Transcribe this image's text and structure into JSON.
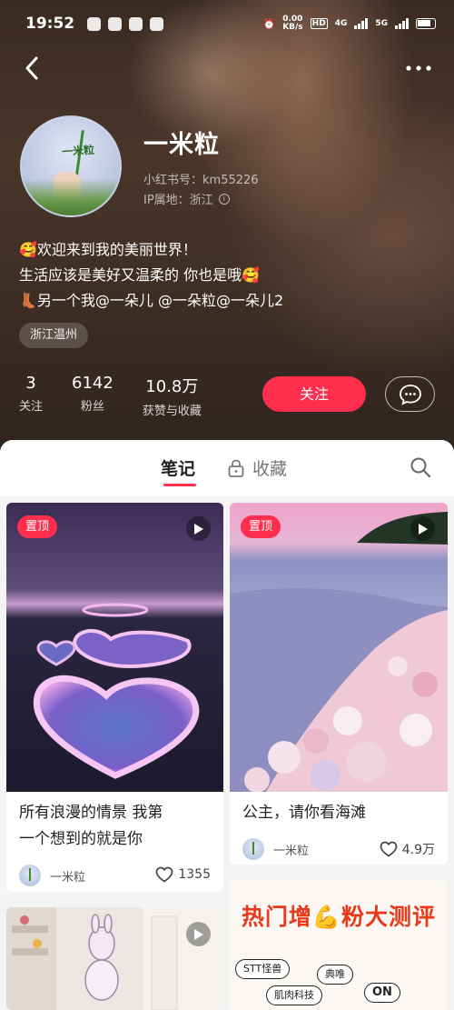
{
  "status_bar": {
    "time": "19:52",
    "speed": "0.00",
    "speed_unit": "KB/s",
    "hd": "HD",
    "net1": "4G",
    "net2": "5G"
  },
  "profile": {
    "avatar_text": "一米粒",
    "name": "一米粒",
    "xhs_id": "小红书号：km55226",
    "ip": "IP属地：浙江",
    "bio_lines": [
      "🥰欢迎来到我的美丽世界！",
      "生活应该是美好又温柔的 你也是哦🥰",
      "👢另一个我@一朵儿 @一朵粒@一朵儿2"
    ],
    "tag": "浙江温州",
    "stats": [
      {
        "num": "3",
        "label": "关注"
      },
      {
        "num": "6142",
        "label": "粉丝"
      },
      {
        "num": "10.8万",
        "label": "获赞与收藏"
      }
    ],
    "follow_label": "关注"
  },
  "tabs": {
    "notes": "笔记",
    "collect": "收藏"
  },
  "cards": [
    {
      "pin": "置顶",
      "title_lines": [
        "所有浪漫的情景 我第",
        "一个想到的就是你"
      ],
      "author": "一米粒",
      "likes": "1355"
    },
    {
      "pin": "置顶",
      "title_lines": [
        "公主，请你看海滩"
      ],
      "author": "一米粒",
      "likes": "4.9万"
    },
    {
      "promo": "热门增💪粉大测评",
      "chips": [
        "STT怪兽",
        "典唯",
        "ON",
        "肌肉科技"
      ]
    }
  ],
  "colors": {
    "accent": "#ff2e4d",
    "promo": "#e8391a"
  }
}
